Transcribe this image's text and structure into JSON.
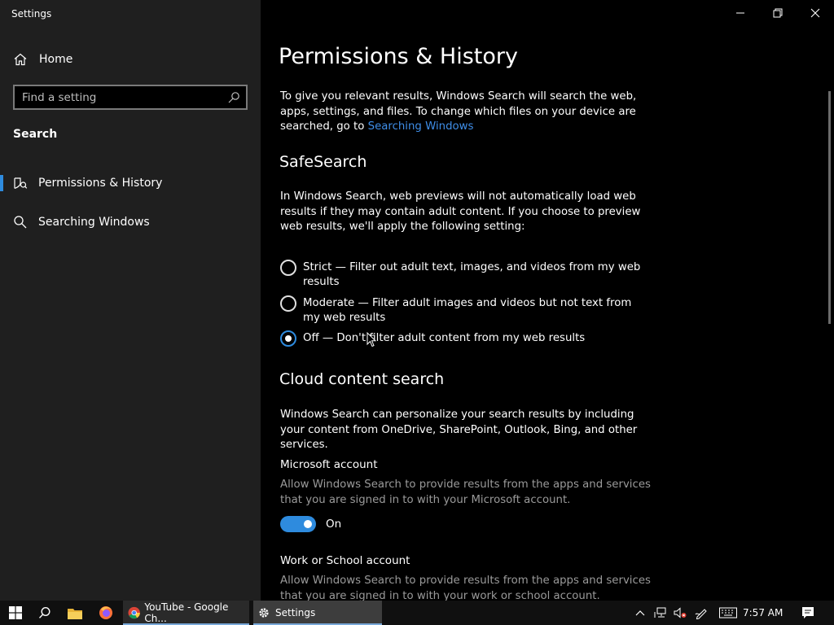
{
  "window": {
    "title": "Settings"
  },
  "sidebar": {
    "home_label": "Home",
    "search_placeholder": "Find a setting",
    "section_heading": "Search",
    "items": [
      {
        "label": "Permissions & History",
        "icon": "shield-search-icon",
        "selected": true
      },
      {
        "label": "Searching Windows",
        "icon": "search-icon",
        "selected": false
      }
    ]
  },
  "main": {
    "title": "Permissions & History",
    "intro_text": "To give you relevant results, Windows Search will search the web, apps, settings, and files. To change which files on your device are searched, go to ",
    "intro_link": "Searching Windows",
    "safesearch": {
      "heading": "SafeSearch",
      "description": "In Windows Search, web previews will not automatically load web results if they may contain adult content. If you choose to preview web results, we'll apply the following setting:",
      "options": [
        {
          "label": "Strict — Filter out adult text, images, and videos from my web results",
          "selected": false
        },
        {
          "label": "Moderate — Filter adult images and videos but not text from my web results",
          "selected": false
        },
        {
          "label": "Off — Don't filter adult content from my web results",
          "selected": true
        }
      ]
    },
    "cloud": {
      "heading": "Cloud content search",
      "description": "Windows Search can personalize your search results by including your content from OneDrive, SharePoint, Outlook, Bing, and other services.",
      "microsoft_account": {
        "heading": "Microsoft account",
        "description": "Allow Windows Search to provide results from the apps and services that you are signed in to with your Microsoft account.",
        "toggle_state": "On",
        "toggle_on": true
      },
      "work_account": {
        "heading": "Work or School account",
        "description": "Allow Windows Search to provide results from the apps and services that you are signed in to with your work or school account."
      }
    }
  },
  "taskbar": {
    "apps": [
      {
        "label": "YouTube - Google Ch...",
        "icon": "chrome-icon"
      },
      {
        "label": "Settings",
        "icon": "gear-icon",
        "active": true
      }
    ],
    "clock": "7:57 AM"
  },
  "colors": {
    "accent": "#2e8bde",
    "link": "#3f8ee8",
    "sidebar_bg": "#1f1f1f",
    "main_bg": "#000000"
  }
}
